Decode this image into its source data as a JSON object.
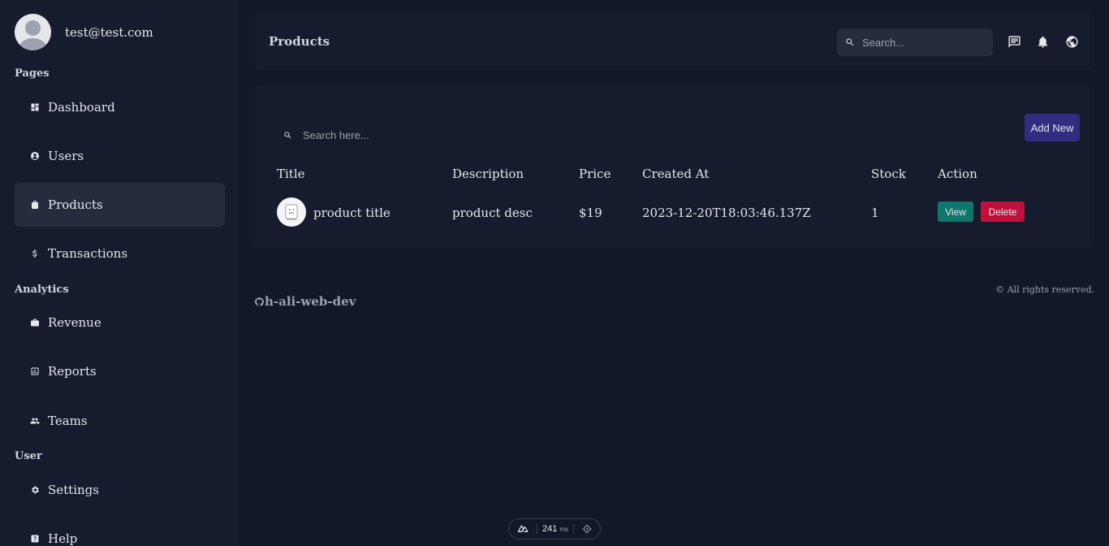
{
  "user": {
    "email": "test@test.com"
  },
  "sidebar": {
    "sections": [
      {
        "title": "Pages"
      },
      {
        "title": "Analytics"
      },
      {
        "title": "User"
      }
    ],
    "items": [
      {
        "label": "Dashboard",
        "icon": "dashboard-icon"
      },
      {
        "label": "Users",
        "icon": "user-icon"
      },
      {
        "label": "Products",
        "icon": "shopping-bag-icon",
        "active": true
      },
      {
        "label": "Transactions",
        "icon": "dollar-icon"
      },
      {
        "label": "Revenue",
        "icon": "briefcase-icon"
      },
      {
        "label": "Reports",
        "icon": "chart-icon"
      },
      {
        "label": "Teams",
        "icon": "group-icon"
      },
      {
        "label": "Settings",
        "icon": "gear-icon"
      },
      {
        "label": "Help",
        "icon": "help-icon"
      }
    ]
  },
  "header": {
    "title": "Products",
    "search_placeholder": "Search...",
    "icons": [
      "chat-icon",
      "bell-icon",
      "globe-icon"
    ]
  },
  "products": {
    "search_placeholder": "Search here...",
    "add_label": "Add New",
    "columns": [
      "Title",
      "Description",
      "Price",
      "Created At",
      "Stock",
      "Action"
    ],
    "rows": [
      {
        "title": "product title",
        "description": "product desc",
        "price": "$19",
        "created_at": "2023-12-20T18:03:46.137Z",
        "stock": "1",
        "view_label": "View",
        "delete_label": "Delete"
      }
    ]
  },
  "footer": {
    "brand": "h-ali-web-dev",
    "copyright": "© All rights reserved."
  },
  "devbar": {
    "time": "241",
    "unit": "ms"
  },
  "colors": {
    "background": "#111827",
    "panel": "#161c2d",
    "active": "#252c3d",
    "add_button": "#312e81",
    "view_button": "#0f766e",
    "delete_button": "#be123c"
  }
}
